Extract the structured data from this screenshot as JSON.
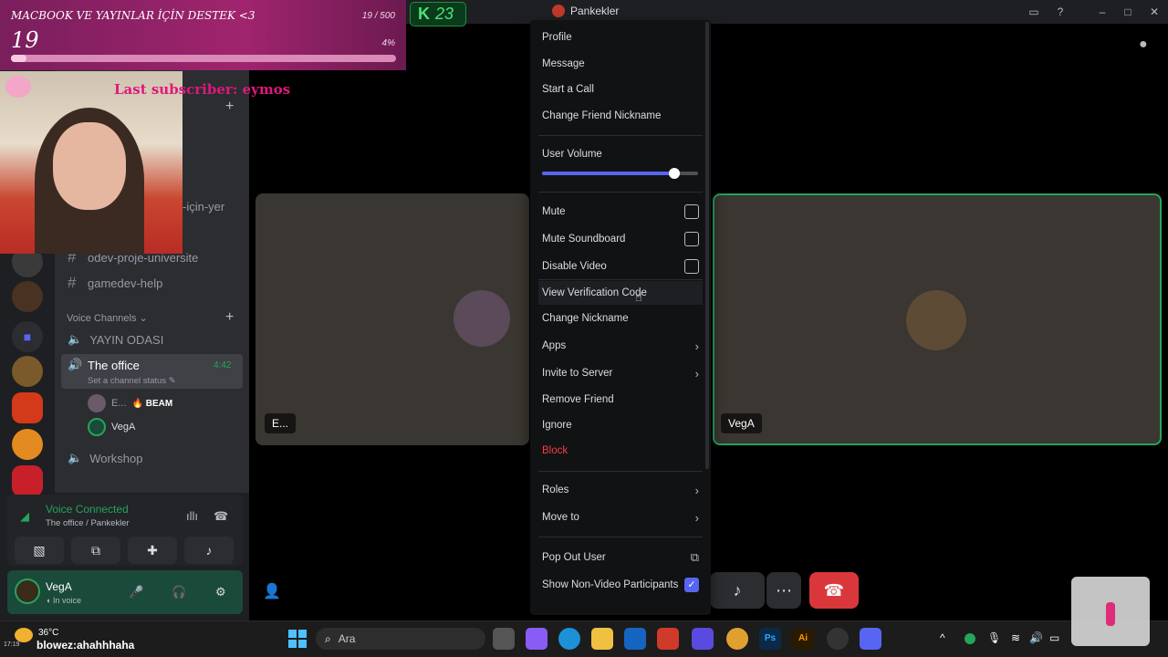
{
  "window": {
    "title": "Pankekler"
  },
  "stream_overlay": {
    "goal_title": "MACBOOK VE YAYINLAR İÇİN DESTEK <3",
    "goal_current": "19",
    "goal_count": "19 / 500",
    "goal_percent_label": "4%",
    "goal_progress": 0.04,
    "counter_value": "23",
    "last_subscriber": "Last subscriber: eymos"
  },
  "sidebar": {
    "channels": [
      {
        "name": "-için-yer"
      },
      {
        "name": "odev-proje-universite"
      },
      {
        "name": "gamedev-help"
      }
    ],
    "voice_category": "Voice Channels",
    "voice_channels": [
      {
        "name": "YAYIN ODASI"
      },
      {
        "name": "The office",
        "timer": "4:42",
        "status": "Set a channel status"
      },
      {
        "name": "Workshop"
      }
    ],
    "voice_users": [
      {
        "name": "E...",
        "badge": "🔥 BEAM"
      },
      {
        "name": "VegA"
      }
    ]
  },
  "voice_status": {
    "title": "Voice Connected",
    "subtitle": "The office / Pankekler"
  },
  "user_panel": {
    "username": "VegA",
    "status": "In voice"
  },
  "stage": {
    "tiles": [
      {
        "label": "E..."
      },
      {
        "label": "VegA"
      }
    ]
  },
  "context_menu": {
    "items_top": [
      "Profile",
      "Message",
      "Start a Call",
      "Change Friend Nickname"
    ],
    "volume_label": "User Volume",
    "volume_level": 0.85,
    "checks": [
      {
        "label": "Mute",
        "checked": false
      },
      {
        "label": "Mute Soundboard",
        "checked": false
      },
      {
        "label": "Disable Video",
        "checked": false
      }
    ],
    "items_mid": [
      {
        "label": "View Verification Code",
        "submenu": false
      },
      {
        "label": "Change Nickname",
        "submenu": false
      },
      {
        "label": "Apps",
        "submenu": true
      },
      {
        "label": "Invite to Server",
        "submenu": true
      },
      {
        "label": "Remove Friend",
        "submenu": false
      },
      {
        "label": "Ignore",
        "submenu": false
      }
    ],
    "danger_item": "Block",
    "items_roles": [
      {
        "label": "Roles",
        "submenu": true
      },
      {
        "label": "Move to",
        "submenu": true
      }
    ],
    "pop_out": "Pop Out User",
    "show_non_video": "Show Non-Video Participants",
    "show_non_video_checked": true
  },
  "taskbar": {
    "weather_temp": "36°C",
    "weather_ticker": "blowez:ahahhhaha",
    "clock": "17:19",
    "search_placeholder": "Ara"
  },
  "colors": {
    "accent": "#5865f2",
    "danger": "#f23f43",
    "speaking": "#23a55a",
    "hangup": "#da373c"
  }
}
